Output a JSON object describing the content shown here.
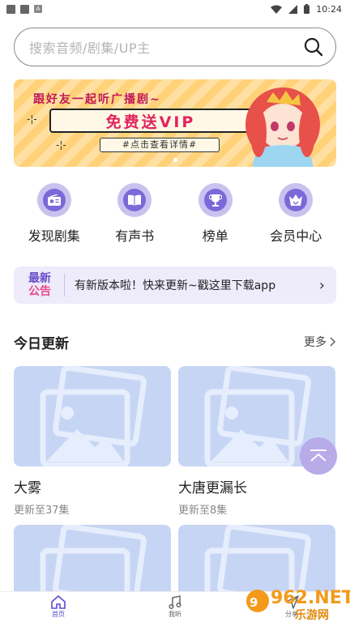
{
  "status_bar": {
    "time": "10:24"
  },
  "search": {
    "placeholder": "搜索音频/剧集/UP主"
  },
  "banner": {
    "headline": "跟好友一起听广播剧~",
    "main": "免费送VIP",
    "sub": "#点击查看详情#"
  },
  "quick_nav": [
    {
      "label": "发现剧集",
      "icon": "radio-icon"
    },
    {
      "label": "有声书",
      "icon": "book-icon"
    },
    {
      "label": "榜单",
      "icon": "trophy-icon"
    },
    {
      "label": "会员中心",
      "icon": "crown-icon"
    }
  ],
  "notice": {
    "tag_line1": "最新",
    "tag_line2": "公告",
    "text": "有新版本啦！快来更新~戳这里下载app"
  },
  "today": {
    "title": "今日更新",
    "more": "更多",
    "items": [
      {
        "title": "大雾",
        "sub": "更新至37集"
      },
      {
        "title": "大唐更漏长",
        "sub": "更新至8集"
      }
    ]
  },
  "tabs": [
    {
      "label": "首页",
      "icon": "home-icon"
    },
    {
      "label": "我听",
      "icon": "music-icon"
    },
    {
      "label": "分享",
      "icon": "send-icon"
    }
  ],
  "watermark": {
    "brand": "962.NET",
    "sub": "乐游网"
  },
  "colors": {
    "accent": "#7b68d9",
    "thumb": "#c7d5f5",
    "notice_bg": "#eeebfb"
  }
}
